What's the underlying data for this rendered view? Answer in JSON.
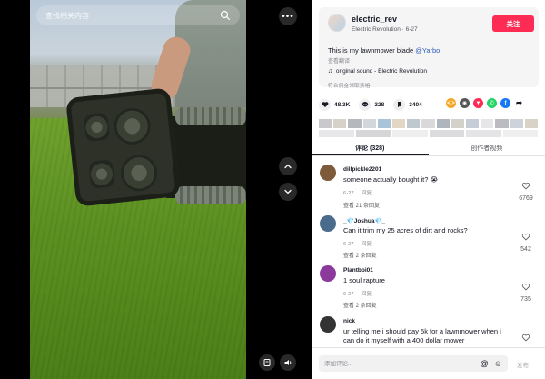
{
  "search": {
    "placeholder": "查找相关内容"
  },
  "author": {
    "name": "electric_rev",
    "subtitle": "Electric Revolution · 6-27",
    "follow_label": "关注",
    "description_text": "This is my lawnmower blade ",
    "description_mention": "@Yarbo",
    "translate_label": "查看翻译",
    "sound": "original sound - Electric Revolution",
    "eligible_label": "符合佣金领取资格"
  },
  "stats": {
    "likes": "48.3K",
    "comments": "328",
    "saves": "3404"
  },
  "share_icons": [
    {
      "name": "embed-icon",
      "color": "#f5a623"
    },
    {
      "name": "friends-icon",
      "color": "#555555"
    },
    {
      "name": "repost-icon",
      "color": "#fe2c55"
    },
    {
      "name": "whatsapp-icon",
      "color": "#25d366"
    },
    {
      "name": "facebook-icon",
      "color": "#1877f2"
    },
    {
      "name": "share-arrow-icon",
      "color": "#161823"
    }
  ],
  "tabs": [
    {
      "label": "评论 (328)",
      "active": true
    },
    {
      "label": "创作者视频",
      "active": false
    }
  ],
  "comments": [
    {
      "user": "dillpickle2201",
      "text": "someone actually bought it? 😭",
      "date": "6-27",
      "reply_label": "回复",
      "more_replies": "查看 21 条回复",
      "likes": "6769",
      "avatar_color": "#7c5a3a"
    },
    {
      "user": "_💎Joshua💎_",
      "text": "Can it trim my 25 acres of dirt and rocks?",
      "date": "6-27",
      "reply_label": "回复",
      "more_replies": "查看 2 条回复",
      "likes": "542",
      "avatar_color": "#4a6b8c"
    },
    {
      "user": "Plantboi01",
      "text": "1 soul rapture",
      "date": "6-27",
      "reply_label": "回复",
      "more_replies": "查看 2 条回复",
      "likes": "735",
      "avatar_color": "#8b3a9c"
    },
    {
      "user": "nick",
      "text": "ur telling me i should pay 5k for a lawnmower when i can do it myself with a 400 dollar mower",
      "date": "",
      "reply_label": "",
      "more_replies": "",
      "likes": "47",
      "avatar_color": "#333333"
    }
  ],
  "comment_box": {
    "placeholder": "添加评论...",
    "post_label": "发布"
  },
  "colors": {
    "accent": "#fe2c55",
    "mention": "#2b5db9"
  }
}
